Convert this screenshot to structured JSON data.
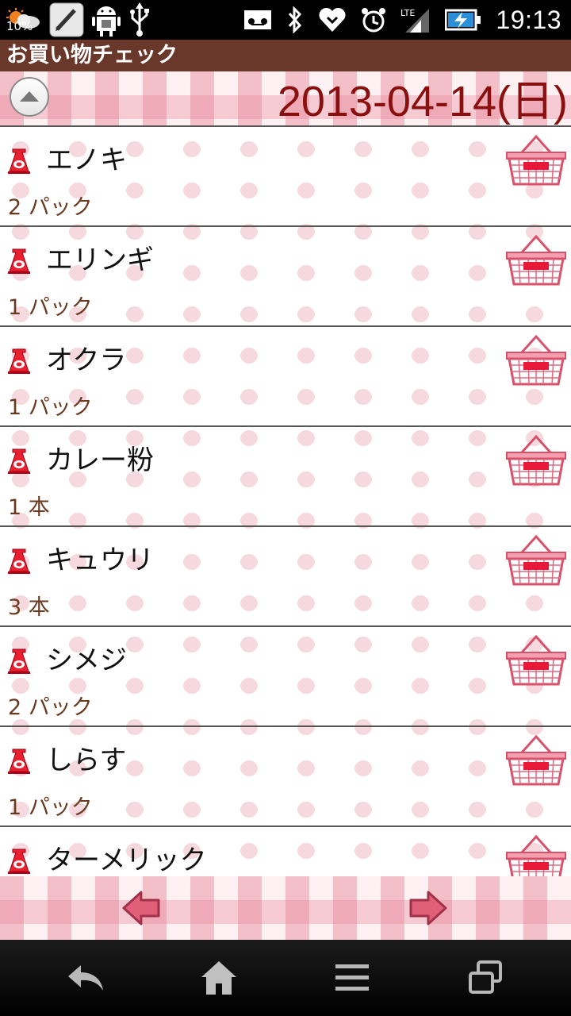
{
  "status_bar": {
    "battery_percent": "10%",
    "time": "19:13",
    "network": "LTE",
    "icons": [
      "weather-icon",
      "pen-icon",
      "android-icon",
      "usb-icon",
      "voicemail-icon",
      "bluetooth-icon",
      "heart-icon",
      "alarm-icon",
      "signal-icon",
      "battery-icon"
    ]
  },
  "app": {
    "title": "お買い物チェック",
    "date": "2013-04-14(日)"
  },
  "items": [
    {
      "name": "エノキ",
      "qty": "2 パック"
    },
    {
      "name": "エリンギ",
      "qty": "1 パック"
    },
    {
      "name": "オクラ",
      "qty": "1 パック"
    },
    {
      "name": "カレー粉",
      "qty": "1 本"
    },
    {
      "name": "キュウリ",
      "qty": "3 本"
    },
    {
      "name": "シメジ",
      "qty": "2 パック"
    },
    {
      "name": "しらす",
      "qty": "1 パック"
    },
    {
      "name": "ターメリック",
      "qty": ""
    }
  ],
  "colors": {
    "title_bar": "#6a382a",
    "date_text": "#8a1010",
    "accent_pink": "#d9506a",
    "qty_text": "#6a3a20"
  },
  "nav": {
    "buttons": [
      "back-icon",
      "home-icon",
      "menu-icon",
      "recent-apps-icon"
    ]
  }
}
